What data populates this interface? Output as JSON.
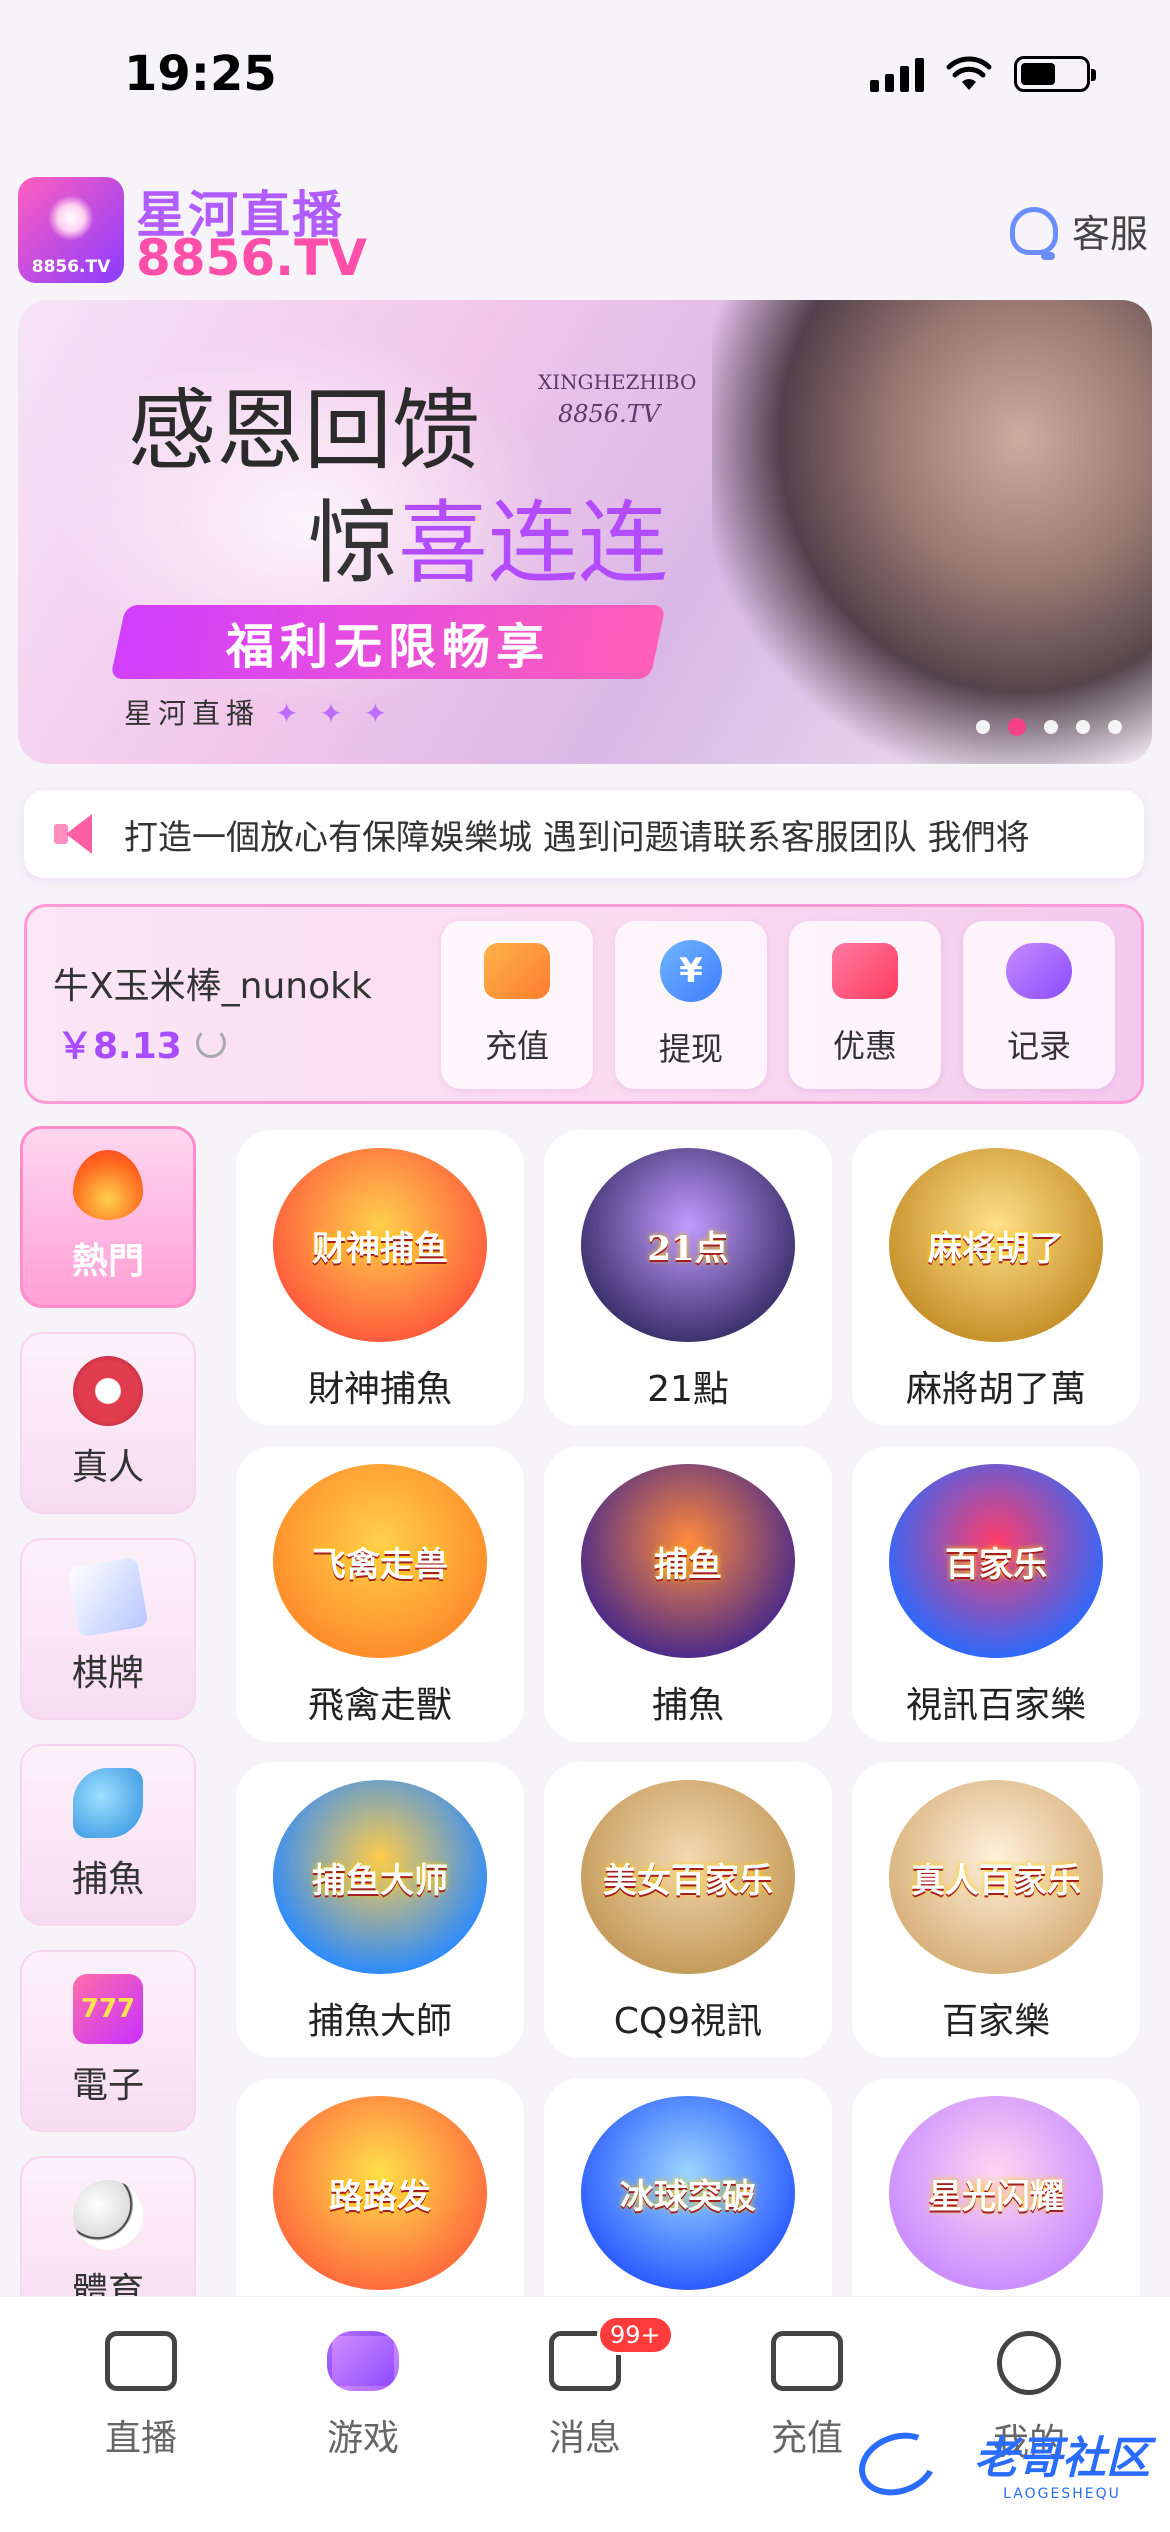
{
  "status_bar": {
    "time": "19:25"
  },
  "header": {
    "logo_mini": "8856.TV",
    "brand_cn": "星河直播",
    "brand_tv": "8856.TV",
    "service_label": "客服"
  },
  "banner": {
    "title_line1": "感恩回馈",
    "title_line2_a": "惊",
    "title_line2_b": "喜连连",
    "watermark_en": "XINGHEZHIBO",
    "watermark_tv": "8856.TV",
    "pill": "福利无限畅享",
    "foot": "星河直播",
    "foot_stars": "✦ ✦ ✦",
    "slide_index": 2,
    "slide_count": 5
  },
  "marquee": {
    "text": "打造一個放心有保障娛樂城  遇到问题请联系客服团队 我們将"
  },
  "wallet": {
    "username": "牛X玉米棒_nunokk",
    "balance": "￥8.13",
    "actions": [
      {
        "label": "充值",
        "icon": "wallet-icon"
      },
      {
        "label": "提现",
        "icon": "yen-icon"
      },
      {
        "label": "优惠",
        "icon": "coupon-icon"
      },
      {
        "label": "记录",
        "icon": "gamepad-icon"
      }
    ]
  },
  "categories": [
    {
      "label": "熱門",
      "icon": "fire-icon",
      "active": true
    },
    {
      "label": "真人",
      "icon": "casino-chip-icon",
      "active": false
    },
    {
      "label": "棋牌",
      "icon": "playing-cards-icon",
      "active": false
    },
    {
      "label": "捕魚",
      "icon": "shark-icon",
      "active": false
    },
    {
      "label": "電子",
      "icon": "slot-777-icon",
      "active": false
    },
    {
      "label": "體育",
      "icon": "soccer-ball-icon",
      "active": false
    }
  ],
  "games": [
    {
      "name": "財神捕魚",
      "art_text": "财神捕鱼",
      "colors": [
        "#ff5a3c",
        "#ffd04c"
      ]
    },
    {
      "name": "21點",
      "art_text": "21点",
      "colors": [
        "#3a2f6a",
        "#c19bff"
      ]
    },
    {
      "name": "麻將胡了萬",
      "art_text": "麻将胡了",
      "colors": [
        "#c6902a",
        "#ffe08a"
      ]
    },
    {
      "name": "飛禽走獸",
      "art_text": "飞禽走兽",
      "colors": [
        "#ff8c2a",
        "#ffd04c"
      ]
    },
    {
      "name": "捕魚",
      "art_text": "捕鱼",
      "colors": [
        "#4a2a8a",
        "#ff8a3c"
      ]
    },
    {
      "name": "視訊百家樂",
      "art_text": "百家乐",
      "colors": [
        "#2a6aff",
        "#ff3c6a"
      ]
    },
    {
      "name": "捕魚大師",
      "art_text": "捕鱼大师",
      "colors": [
        "#2a8aff",
        "#ffcc4c"
      ]
    },
    {
      "name": "CQ9視訊",
      "art_text": "美女百家乐",
      "colors": [
        "#c49a5a",
        "#f3d9b0"
      ]
    },
    {
      "name": "百家樂",
      "art_text": "真人百家乐",
      "colors": [
        "#d8b07a",
        "#fff1dc"
      ]
    },
    {
      "name": "",
      "art_text": "路路发",
      "colors": [
        "#ff6a3c",
        "#ffe04c"
      ]
    },
    {
      "name": "",
      "art_text": "冰球突破",
      "colors": [
        "#2a5aff",
        "#9ad6ff"
      ]
    },
    {
      "name": "",
      "art_text": "星光闪耀",
      "colors": [
        "#c98cff",
        "#ffd6f1"
      ]
    }
  ],
  "tabbar": {
    "tabs": [
      {
        "label": "直播",
        "icon": "live-camera-icon",
        "active": false
      },
      {
        "label": "游戏",
        "icon": "gamepad-icon",
        "active": true
      },
      {
        "label": "消息",
        "icon": "message-icon",
        "active": false,
        "badge": "99+"
      },
      {
        "label": "充值",
        "icon": "wallet-icon",
        "active": false
      },
      {
        "label": "我的",
        "icon": "profile-face-icon",
        "active": false
      }
    ]
  },
  "watermark": {
    "text": "老哥社区",
    "sub": "LAOGESHEQU"
  }
}
